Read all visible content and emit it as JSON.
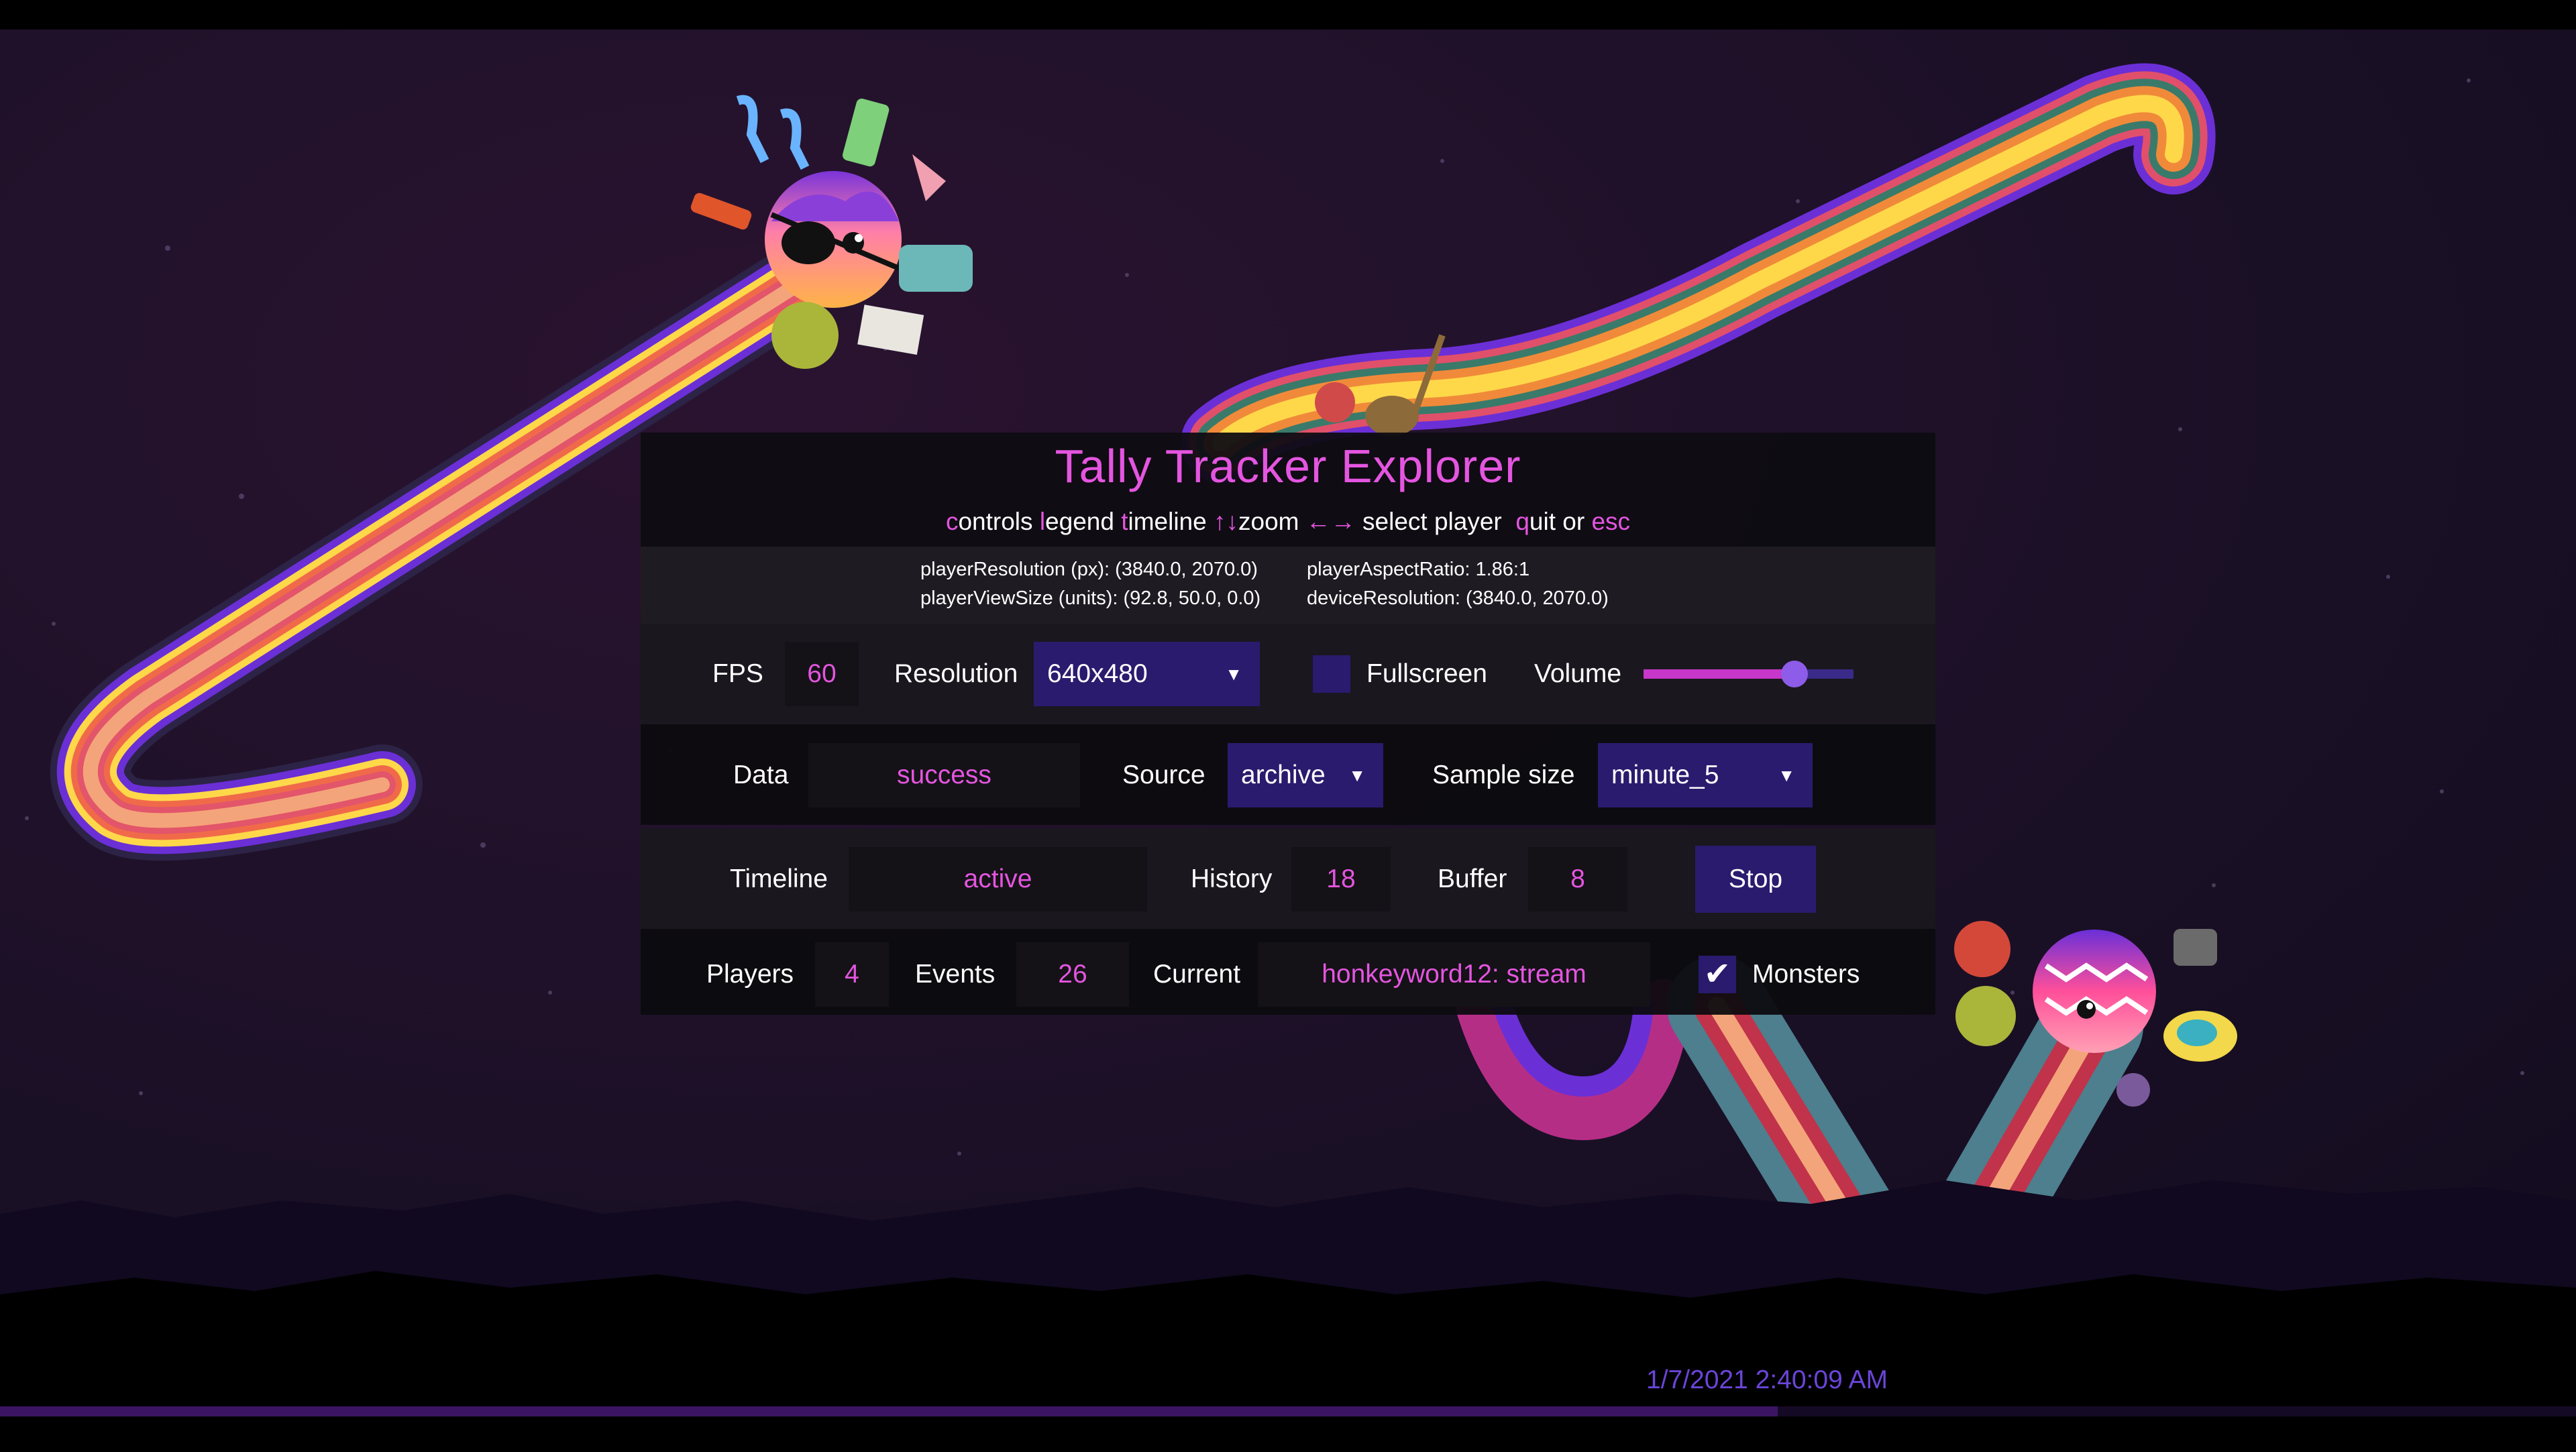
{
  "app": {
    "title": "Tally Tracker Explorer",
    "shortcuts": {
      "controls_key": "c",
      "controls_rest": "ontrols",
      "legend_key": "l",
      "legend_rest": "egend",
      "timeline_key": "t",
      "timeline_rest": "imeline",
      "zoom_key": "↑↓",
      "zoom_rest": "zoom",
      "select_key": "←→",
      "select_rest": "select player",
      "quit_key": "q",
      "quit_rest": "uit or",
      "esc": "esc"
    }
  },
  "info": {
    "player_resolution": "playerResolution (px): (3840.0, 2070.0)",
    "player_view_size": "playerViewSize (units): (92.8, 50.0, 0.0)",
    "player_aspect_ratio": "playerAspectRatio: 1.86:1",
    "device_resolution": "deviceResolution: (3840.0, 2070.0)"
  },
  "row1": {
    "fps_label": "FPS",
    "fps_value": "60",
    "resolution_label": "Resolution",
    "resolution_value": "640x480",
    "fullscreen_label": "Fullscreen",
    "fullscreen_checked": false,
    "volume_label": "Volume",
    "volume_level": 0.72
  },
  "row2": {
    "data_label": "Data",
    "data_value": "success",
    "source_label": "Source",
    "source_value": "archive",
    "sample_size_label": "Sample size",
    "sample_size_value": "minute_5"
  },
  "row3": {
    "timeline_label": "Timeline",
    "timeline_value": "active",
    "history_label": "History",
    "history_value": "18",
    "buffer_label": "Buffer",
    "buffer_value": "8",
    "stop_label": "Stop"
  },
  "row4": {
    "players_label": "Players",
    "players_value": "4",
    "events_label": "Events",
    "events_value": "26",
    "current_label": "Current",
    "current_value": "honkeyword12: stream",
    "monsters_label": "Monsters",
    "monsters_checked": true,
    "check_glyph": "✔"
  },
  "footer": {
    "timestamp": "1/7/2021 2:40:09 AM",
    "progress": 0.69
  },
  "colors": {
    "accent": "#e455e0",
    "select_bg": "#2a1b6e",
    "timestamp": "#6a45d8"
  },
  "icons": [
    "dropdown-caret-icon",
    "checkmark-icon",
    "slider-thumb-icon"
  ]
}
